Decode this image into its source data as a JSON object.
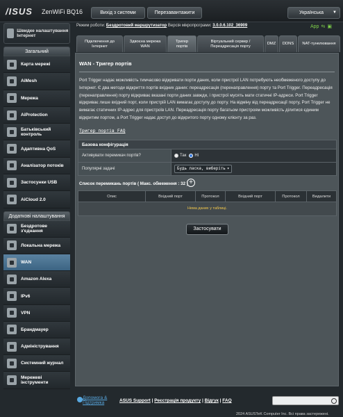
{
  "topbar": {
    "brand": "/ISUS",
    "model": "ZenWiFi BQ16",
    "logout_label": "Вихід з системи",
    "reboot_label": "Перезавантажити",
    "language": "Українська"
  },
  "status": {
    "mode_label": "Режим роботи:",
    "mode_value": "Бездротовий маршрутизатор",
    "fw_label": "Версія мікропрограми:",
    "fw_value": "3.0.0.6.102_36909",
    "app_label": "App"
  },
  "sidebar": {
    "quick_setup": "Швидке налаштування Інтернет",
    "group1_title": "Загальний",
    "group1": [
      {
        "label": "Карта мережі",
        "name": "sidebar-item-network-map"
      },
      {
        "label": "AiMesh",
        "name": "sidebar-item-aimesh"
      },
      {
        "label": "Мережа",
        "name": "sidebar-item-network"
      },
      {
        "label": "AiProtection",
        "name": "sidebar-item-aiprotection"
      },
      {
        "label": "Батьківський контроль",
        "name": "sidebar-item-parental-control"
      },
      {
        "label": "Адаптивна QoS",
        "name": "sidebar-item-adaptive-qos"
      },
      {
        "label": "Аналізатор потоків",
        "name": "sidebar-item-traffic-analyzer"
      },
      {
        "label": "Застосунки USB",
        "name": "sidebar-item-usb-apps"
      },
      {
        "label": "AiCloud 2.0",
        "name": "sidebar-item-aicloud"
      }
    ],
    "group2_title": "Додаткові налаштування",
    "group2": [
      {
        "label": "Бездротове з'єднання",
        "name": "sidebar-item-wireless"
      },
      {
        "label": "Локальна мережа",
        "name": "sidebar-item-lan"
      },
      {
        "label": "WAN",
        "name": "sidebar-item-wan"
      },
      {
        "label": "Amazon Alexa",
        "name": "sidebar-item-alexa"
      },
      {
        "label": "IPv6",
        "name": "sidebar-item-ipv6"
      },
      {
        "label": "VPN",
        "name": "sidebar-item-vpn"
      },
      {
        "label": "Брандмауер",
        "name": "sidebar-item-firewall"
      },
      {
        "label": "Адміністрування",
        "name": "sidebar-item-administration"
      },
      {
        "label": "Системний журнал",
        "name": "sidebar-item-system-log"
      },
      {
        "label": "Мережеві інструменти",
        "name": "sidebar-item-network-tools"
      }
    ]
  },
  "tabs": [
    "Підключення до Інтернет",
    "Здвоєна мережа WAN",
    "Тригер портів",
    "Віртуальний сервер / Переадресація порту",
    "DMZ",
    "DDNS",
    "NAT-тунелювання"
  ],
  "main": {
    "title": "WAN - Тригер портів",
    "description": "Port Trigger надає можливість тимчасово відкривати порти даних, коли пристрої LAN потребують необмеженого доступу до Інтернет. Є два методи відкриття портів вхідних даних: переадресація (перенаправлення) порту та Port Trigger. Переадресація (перенаправлення) порту відкриває вказані порти даних завжди, і пристрої мусять мати статичні IP-адреси. Port Trigger відкриває лише вхідний порт, коли пристрій LAN вимагає доступу до порту. На відміну від переадресації порту, Port Trigger не вимагає статичних IP-адрес для пристроїв LAN. Переадресація порту багатьом пристроям можливість ділитися єдиним відкритим портом, а Port Trigger надає доступ до відкритого порту одному клієнту за раз.",
    "faq_link": "Тригер портів FAQ",
    "config_header": "Базова конфігурація",
    "enable_label": "Активувати перемикач портів?",
    "yes_label": "Так",
    "no_label": "Ні",
    "preset_label": "Популярні задачі",
    "preset_value": "Будь ласка, виберіть",
    "list_title": "Список перемикань портів ( Макс. обмеження : 32 )",
    "columns": [
      "Опис",
      "Вхідний порт",
      "Протокол",
      "Вхідний порт",
      "Протокол",
      "Видалити"
    ],
    "empty_text": "Нема даних у таблиці.",
    "apply_label": "Застосувати"
  },
  "footer": {
    "help": "Допомога & Підтримка",
    "links": [
      "ASUS Support",
      "Реєстрація продукту",
      "Відгук",
      "FAQ"
    ],
    "copyright": "2024 ASUSTeK Computer Inc. Всі права застережені."
  }
}
